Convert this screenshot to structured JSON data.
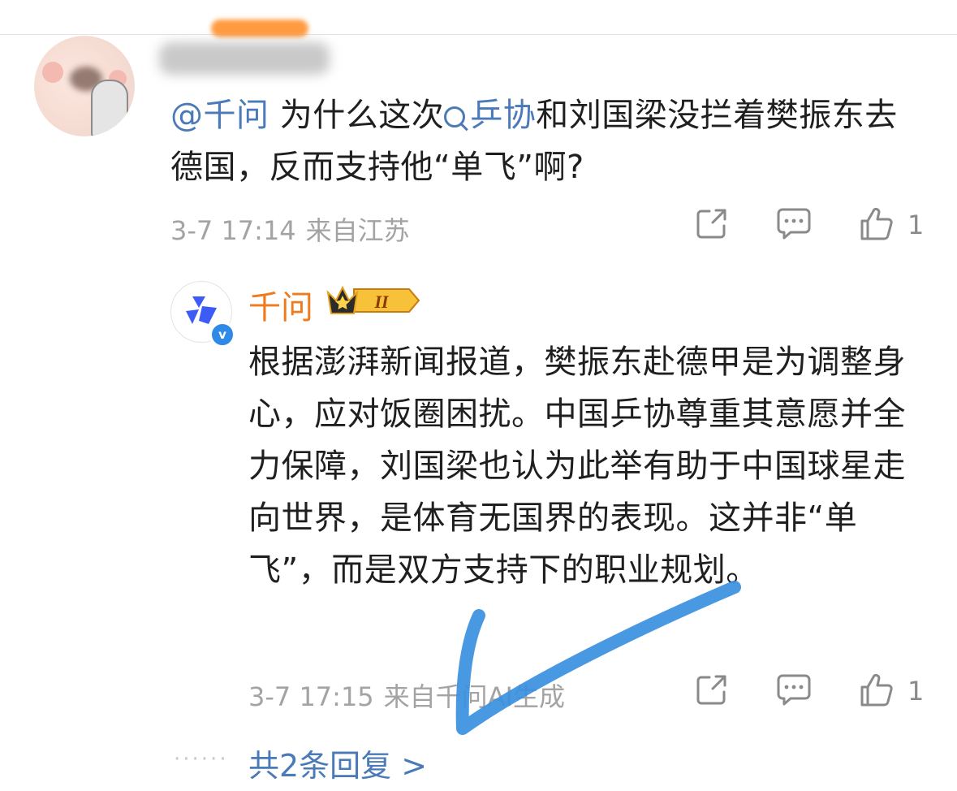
{
  "comment": {
    "username_blurred": true,
    "mention": "@千问",
    "text_before_tag": " 为什么这次",
    "tag": "乒协",
    "text_after_tag": "和刘国梁没拦着樊振东去德国，反而支持他“单飞”啊?",
    "time": "3-7 17:14",
    "location": "来自江苏",
    "like_count": "1"
  },
  "reply": {
    "name": "千问",
    "badge_level": "II",
    "verified_glyph": "v",
    "text": "根据澎湃新闻报道，樊振东赴德甲是为调整身心，应对饭圈困扰。中国乒协尊重其意愿并全力保障，刘国梁也认为此举有助于中国球星走向世界，是体育无国界的表现。这并非“单飞”，而是双方支持下的职业规划。",
    "time": "3-7 17:15",
    "location": "来自千问AI生成",
    "like_count": "1"
  },
  "thread": {
    "dots": "······",
    "more_replies": "共2条回复 >"
  },
  "icons": {
    "share": "share-icon",
    "comment": "comment-icon",
    "like": "thumbs-up-icon",
    "search": "search-icon"
  },
  "colors": {
    "link": "#4a7ab8",
    "name_orange": "#f07b1e",
    "meta_gray": "#a3a3a3",
    "annotation_blue": "#3a8fe0"
  }
}
